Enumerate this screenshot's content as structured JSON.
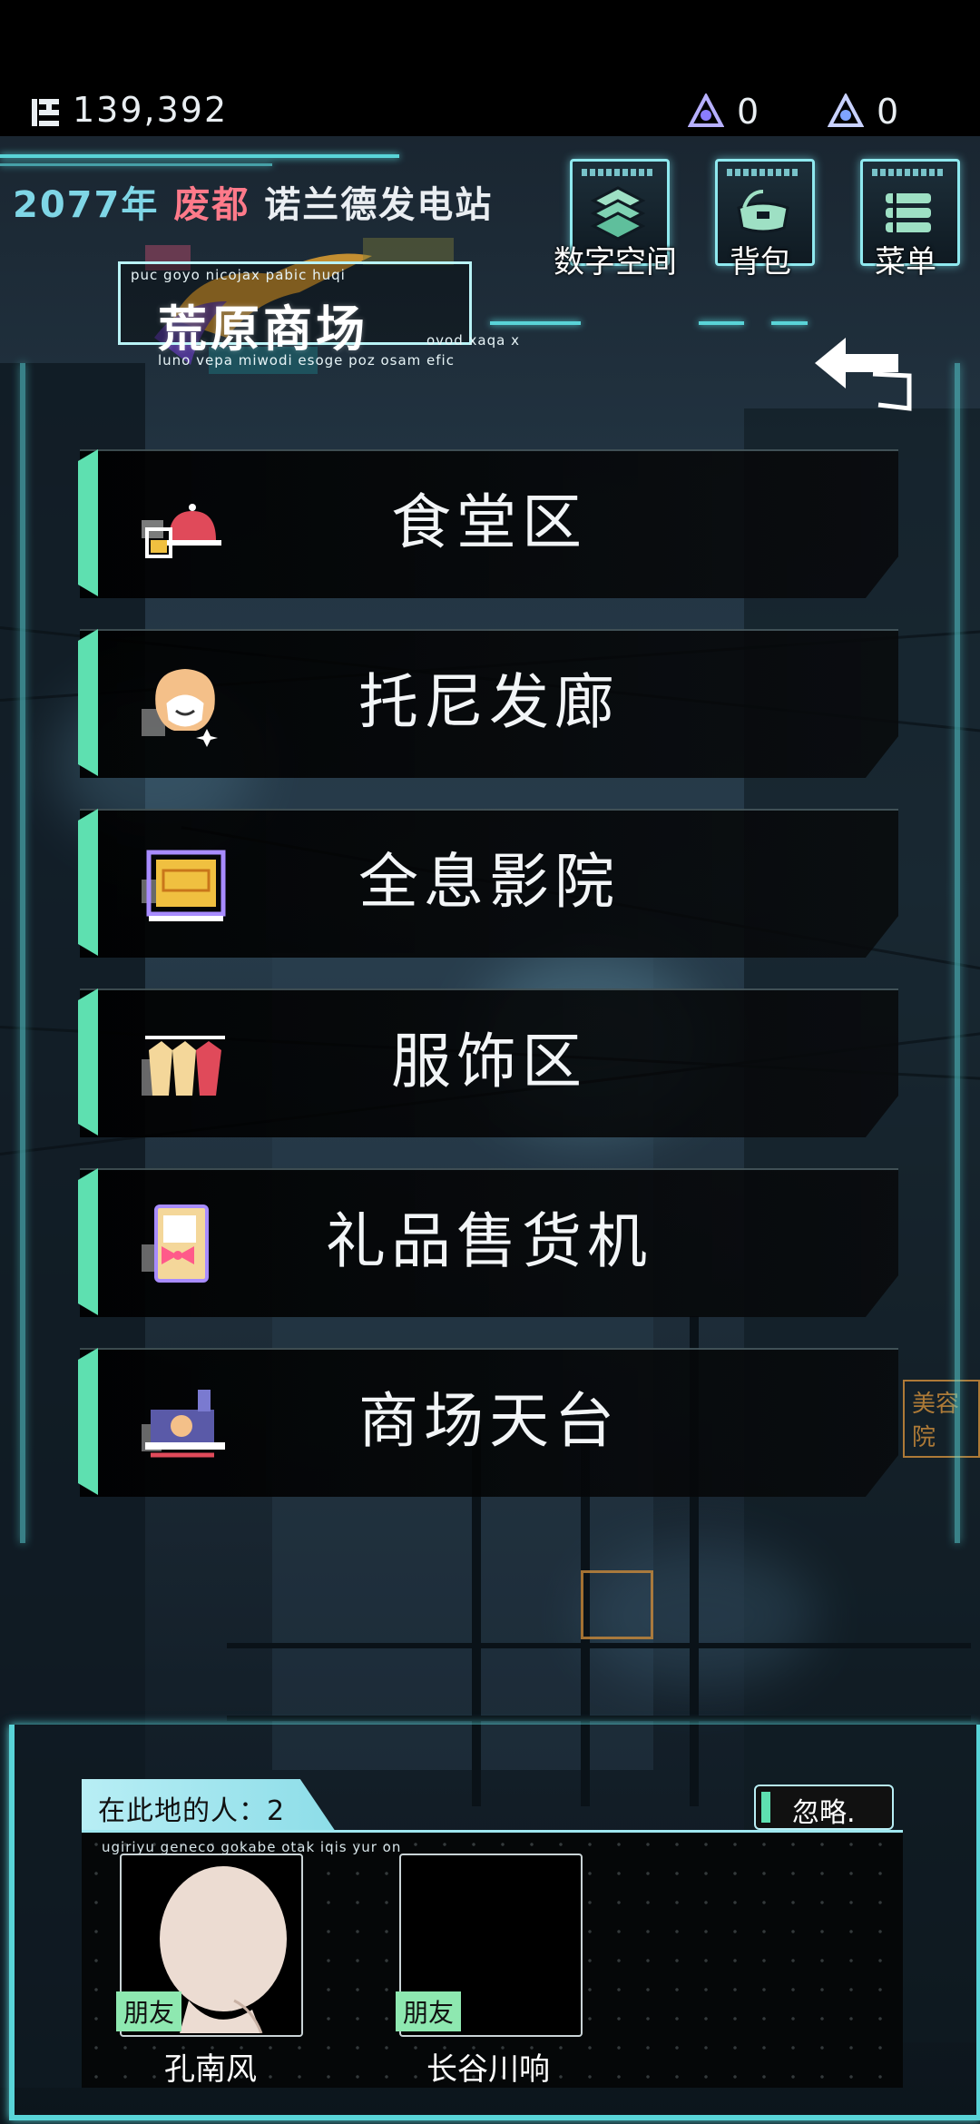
{
  "status": {
    "coins": "139,392",
    "resource_1": "0",
    "resource_2": "0",
    "icons": [
      "coin-icon",
      "crystal-icon",
      "crystal-alt-icon"
    ]
  },
  "location": {
    "year": "2077年",
    "zone": "废都",
    "place": "诺兰德发电站"
  },
  "top_buttons": {
    "digital": "数字空间",
    "bag": "背包",
    "menu": "菜单"
  },
  "banner": {
    "title": "荒原商场",
    "tiny_top": "puc goyo nicojax pabic huqi",
    "tiny_mid": "ovod xaqa x",
    "tiny_bottom": "luno vepa miwodi esoge poz osam efic"
  },
  "menu_items": [
    {
      "label": "食堂区",
      "icon": "cafeteria-icon"
    },
    {
      "label": "托尼发廊",
      "icon": "hair-salon-icon"
    },
    {
      "label": "全息影院",
      "icon": "cinema-icon"
    },
    {
      "label": "服饰区",
      "icon": "clothing-icon"
    },
    {
      "label": "礼品售货机",
      "icon": "gift-machine-icon"
    },
    {
      "label": "商场天台",
      "icon": "rooftop-icon"
    }
  ],
  "people": {
    "header": "在此地的人：2",
    "ignore": "忽略.",
    "tiny": "ugiriyu geneco gokabe otak iqis yur on",
    "list": [
      {
        "name": "孔南风",
        "tag": "朋友"
      },
      {
        "name": "长谷川响",
        "tag": "朋友"
      }
    ]
  },
  "colors": {
    "hud_cyan": "#59d4d8",
    "accent_green": "#5ee0b0",
    "zone_pink": "#ff7a8a",
    "year_blue": "#7fd6e6"
  }
}
